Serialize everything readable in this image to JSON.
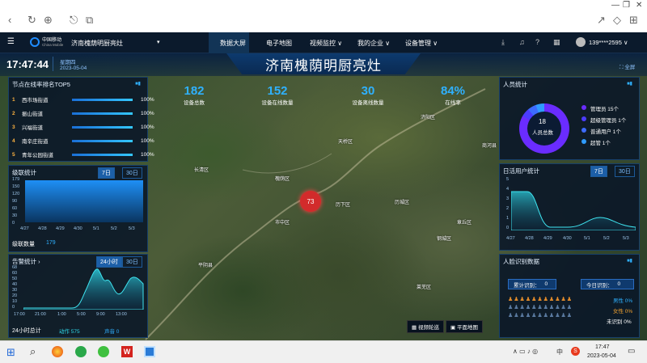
{
  "browser": {
    "nav": [
      "‹",
      "↻",
      "⊕",
      "⎋",
      "⧉"
    ],
    "right": [
      "↗",
      "◇",
      "⊞"
    ],
    "window": [
      "—",
      "❐",
      "✕"
    ]
  },
  "app": {
    "menu_icon": "menu-icon",
    "brand_cn": "中国移动",
    "brand_en": "China Mobile",
    "org": "济南槐荫明厨亮灶",
    "org_caret": "▾",
    "nav": [
      {
        "label": "数据大屏",
        "active": true
      },
      {
        "label": "电子地图",
        "active": false
      },
      {
        "label": "视频监控 ∨",
        "active": false
      },
      {
        "label": "我的企业 ∨",
        "active": false
      },
      {
        "label": "设备管理 ∨",
        "active": false
      }
    ],
    "user": "139****2595 ∨",
    "time": "17:47:44",
    "weekday": "星期四",
    "date": "2023-05-04",
    "title": "济南槐荫明厨亮灶",
    "fullscreen": "⛶ 全屏"
  },
  "stats": [
    {
      "value": "182",
      "label": "设备总数"
    },
    {
      "value": "152",
      "label": "设备在线数量"
    },
    {
      "value": "30",
      "label": "设备离线数量"
    },
    {
      "value": "84%",
      "label": "在线率"
    }
  ],
  "top5": {
    "title": "节点在线率排名TOP5",
    "rows": [
      {
        "rank": "1",
        "name": "西市场街道",
        "pct": "100%",
        "fill": 1.0
      },
      {
        "rank": "2",
        "name": "振山街道",
        "pct": "100%",
        "fill": 1.0
      },
      {
        "rank": "3",
        "name": "兴福街道",
        "pct": "100%",
        "fill": 1.0
      },
      {
        "rank": "4",
        "name": "南辛庄街道",
        "pct": "100%",
        "fill": 1.0
      },
      {
        "rank": "5",
        "name": "青年公园街道",
        "pct": "100%",
        "fill": 1.0
      }
    ]
  },
  "level": {
    "title": "级联统计",
    "tab_7": "7日",
    "tab_30": "30日",
    "count_label": "级联数量",
    "count": "179",
    "yticks": [
      "179",
      "150",
      "120",
      "90",
      "60",
      "30",
      "0"
    ],
    "xticks": [
      "4/27",
      "4/28",
      "4/29",
      "4/30",
      "5/1",
      "5/2",
      "5/3"
    ]
  },
  "alarm": {
    "title": "告警统计 ›",
    "tab_24": "24小时",
    "tab_30": "30日",
    "yticks": [
      "68",
      "60",
      "50",
      "40",
      "30",
      "20",
      "10",
      "0"
    ],
    "xticks": [
      "17:00",
      "21:00",
      "1:00",
      "5:00",
      "9:00",
      "13:00"
    ],
    "total_label": "24小时总计",
    "motion_label": "动作 575",
    "sound_label": "声音 0"
  },
  "people": {
    "title": "人员统计",
    "total": "18",
    "total_label": "人员总数",
    "legend": [
      {
        "label": "管理员 15个",
        "color": "#6a2cff"
      },
      {
        "label": "超级管理员 1个",
        "color": "#4b3cff"
      },
      {
        "label": "普通用户 1个",
        "color": "#3d6bff"
      },
      {
        "label": "超管 1个",
        "color": "#2f9bff"
      }
    ]
  },
  "active": {
    "title": "日活用户统计",
    "tab_7": "7日",
    "tab_30": "30日",
    "yticks": [
      "5",
      "4",
      "3",
      "2",
      "1",
      "0"
    ],
    "xticks": [
      "4/27",
      "4/28",
      "4/29",
      "4/30",
      "5/1",
      "5/2",
      "5/3"
    ]
  },
  "face": {
    "title": "人脸识别数据",
    "total_label": "累计识别：",
    "total": "0",
    "today_label": "今日识别：",
    "today": "0",
    "male": "男性 0%",
    "female": "女性 0%",
    "unknown": "未识别 0%"
  },
  "map": {
    "marker": "73",
    "labels": [
      "长清区",
      "历城区",
      "章丘区",
      "天桥区",
      "槐荫区",
      "历下区",
      "市中区",
      "济阳区",
      "平阴县",
      "莱芜区",
      "钢城区",
      "商河县"
    ],
    "video_btn": "▦ 视频轮巡",
    "plane_btn": "▣ 平面地图"
  },
  "taskbar": {
    "time": "17:47",
    "date": "2023-05-04",
    "ime": "中",
    "tray": "∧ ▭ ♪ ◎"
  }
}
